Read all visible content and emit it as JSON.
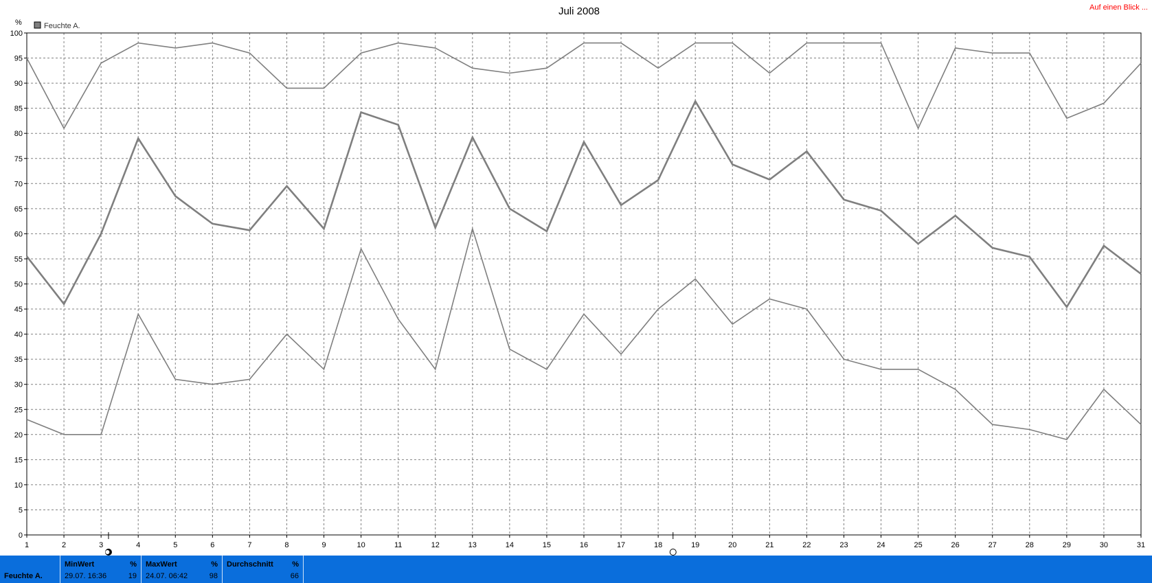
{
  "link_label": "Auf einen Blick ...",
  "colors": {
    "series": "#7f7f7f",
    "grid": "#808080",
    "statsbar": "#0a6edc",
    "link": "#ff0000"
  },
  "stats": {
    "series_label": "Feuchte A.",
    "min": {
      "head": "MinWert",
      "unit": "%",
      "time": "29.07.  16:36",
      "value": "19"
    },
    "max": {
      "head": "MaxWert",
      "unit": "%",
      "time": "24.07.  06:42",
      "value": "98"
    },
    "avg": {
      "head": "Durchschnitt",
      "unit": "%",
      "value": "66"
    }
  },
  "chart_data": {
    "type": "line",
    "title": "Juli 2008",
    "ylabel": "%",
    "legend": [
      "Feuchte A."
    ],
    "legend_position": "top-left",
    "grid": true,
    "x": [
      1,
      2,
      3,
      4,
      5,
      6,
      7,
      8,
      9,
      10,
      11,
      12,
      13,
      14,
      15,
      16,
      17,
      18,
      19,
      20,
      21,
      22,
      23,
      24,
      25,
      26,
      27,
      28,
      29,
      30,
      31
    ],
    "xlim": [
      1,
      31
    ],
    "ylim": [
      0,
      100
    ],
    "yticks": [
      0,
      5,
      10,
      15,
      20,
      25,
      30,
      35,
      40,
      45,
      50,
      55,
      60,
      65,
      70,
      75,
      80,
      85,
      90,
      95,
      100
    ],
    "series": [
      {
        "role": "max",
        "values": [
          95,
          81,
          94,
          98,
          97,
          98,
          96,
          89,
          89,
          96,
          98,
          97,
          93,
          92,
          93,
          98,
          98,
          93,
          98,
          98,
          92,
          98,
          98,
          98,
          81,
          97,
          96,
          96,
          83,
          86,
          94
        ]
      },
      {
        "role": "avg",
        "values": [
          55.5,
          46,
          60,
          79,
          67.5,
          62,
          60.7,
          69.5,
          61,
          84.2,
          81.7,
          61.2,
          79.2,
          65,
          60.5,
          78.3,
          65.7,
          70.7,
          86.4,
          73.8,
          70.8,
          76.4,
          66.8,
          64.6,
          58,
          63.6,
          57.2,
          55.4,
          45.4,
          57.6,
          52
        ]
      },
      {
        "role": "min",
        "values": [
          23,
          20,
          20,
          44,
          31,
          30,
          31,
          40,
          33,
          57,
          43,
          33,
          61,
          37,
          33,
          44,
          36,
          45,
          51,
          42,
          47,
          45,
          35,
          33,
          33,
          29,
          22,
          21,
          19,
          29,
          22
        ]
      }
    ],
    "markers": [
      {
        "x": 3.2,
        "symbol": "filled-circle"
      },
      {
        "x": 18.4,
        "symbol": "open-circle"
      }
    ]
  }
}
